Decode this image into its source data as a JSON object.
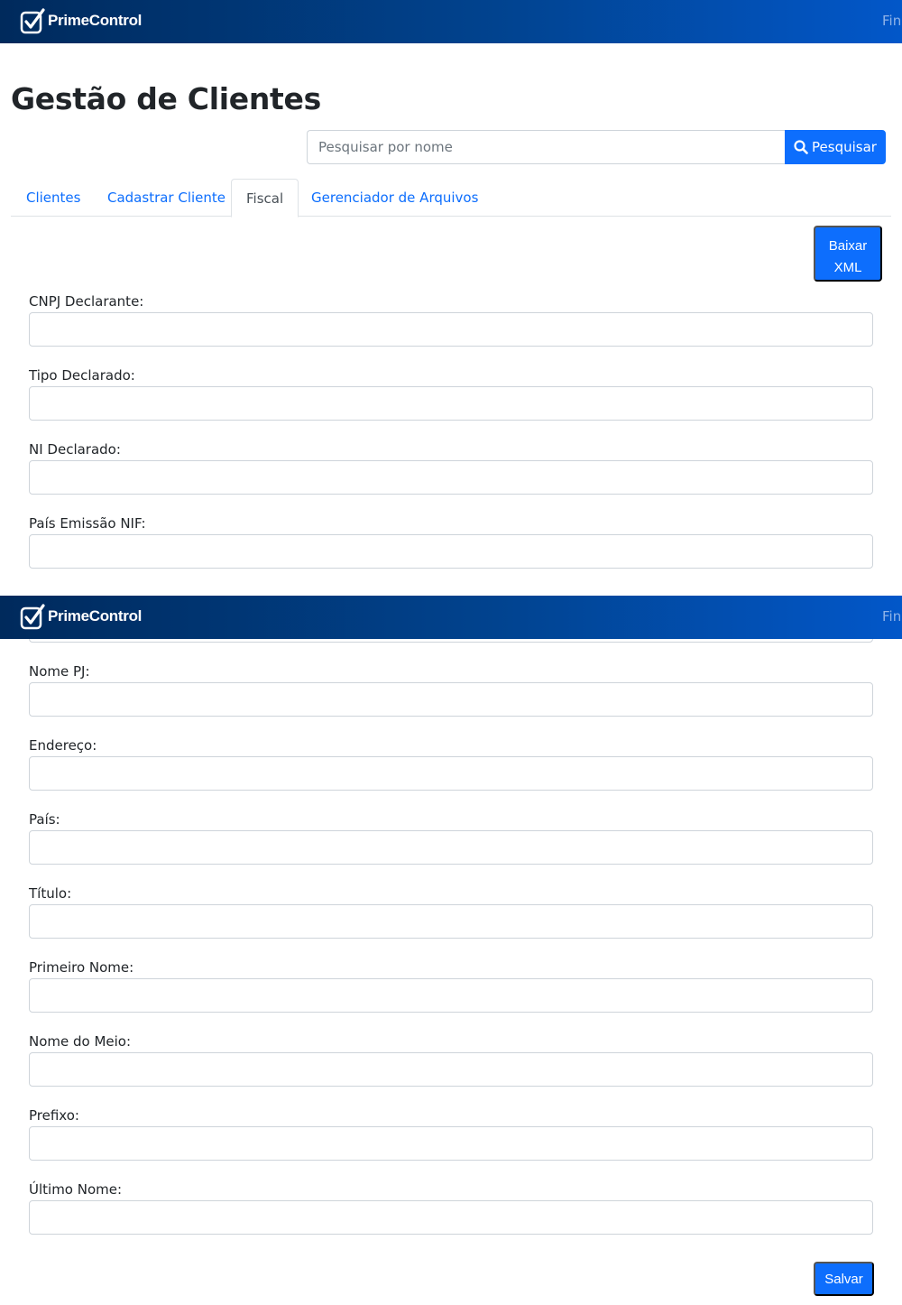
{
  "navbar": {
    "brand": "PrimeControl",
    "nav_link": "Fina"
  },
  "page_title": "Gestão de Clientes",
  "search": {
    "placeholder": "Pesquisar por nome",
    "button_label": "Pesquisar"
  },
  "tabs": [
    {
      "label": "Clientes",
      "active": false
    },
    {
      "label": "Cadastrar Cliente",
      "active": false
    },
    {
      "label": "Fiscal",
      "active": true
    },
    {
      "label": "Gerenciador de Arquivos",
      "active": false
    }
  ],
  "download_xml_button": {
    "line1": "Baixar",
    "line2": "XML"
  },
  "fields": [
    {
      "label": "CNPJ Declarante:",
      "value": ""
    },
    {
      "label": "Tipo Declarado:",
      "value": ""
    },
    {
      "label": "NI Declarado:",
      "value": ""
    },
    {
      "label": "País Emissão NIF:",
      "value": ""
    },
    {
      "label": "Nome PJ:",
      "value": ""
    },
    {
      "label": "Endereço:",
      "value": ""
    },
    {
      "label": "País:",
      "value": ""
    },
    {
      "label": "Título:",
      "value": ""
    },
    {
      "label": "Primeiro Nome:",
      "value": ""
    },
    {
      "label": "Nome do Meio:",
      "value": ""
    },
    {
      "label": "Prefixo:",
      "value": ""
    },
    {
      "label": "Último Nome:",
      "value": ""
    }
  ],
  "save_button": "Salvar",
  "colors": {
    "primary": "#0d6efd",
    "navbar_dark": "#002a5c",
    "navbar_light": "#0257c9"
  }
}
